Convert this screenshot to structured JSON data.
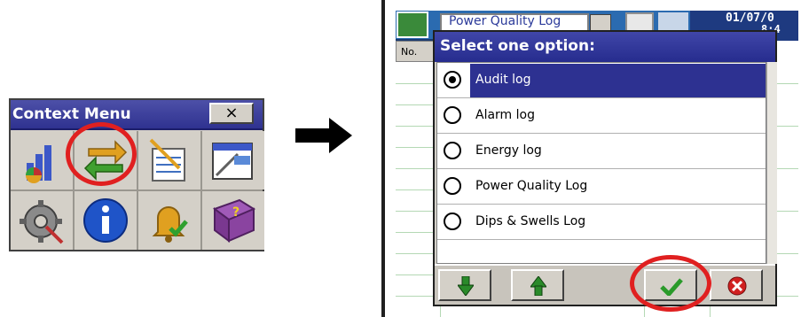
{
  "context_menu": {
    "title": "Context Menu",
    "close_label": "×",
    "icons": [
      "chart-icon",
      "swap-arrows-icon",
      "notepad-icon",
      "window-icon",
      "settings-icon",
      "info-icon",
      "alarm-bell-icon",
      "help-book-icon"
    ]
  },
  "app": {
    "title": "Power Quality Log",
    "date": "01/07/0",
    "time": "8:4",
    "column_header": "No."
  },
  "dialog": {
    "title": "Select one option:",
    "options": [
      {
        "label": "Audit log",
        "selected": true
      },
      {
        "label": "Alarm log",
        "selected": false
      },
      {
        "label": "Energy log",
        "selected": false
      },
      {
        "label": "Power Quality Log",
        "selected": false
      },
      {
        "label": "Dips & Swells Log",
        "selected": false
      }
    ],
    "buttons": [
      "down-arrow-icon",
      "up-arrow-icon",
      "confirm-check-icon",
      "cancel-icon"
    ]
  },
  "colors": {
    "titlebar": "#2f3290",
    "highlight": "#e02020",
    "selection": "#2d3191"
  }
}
